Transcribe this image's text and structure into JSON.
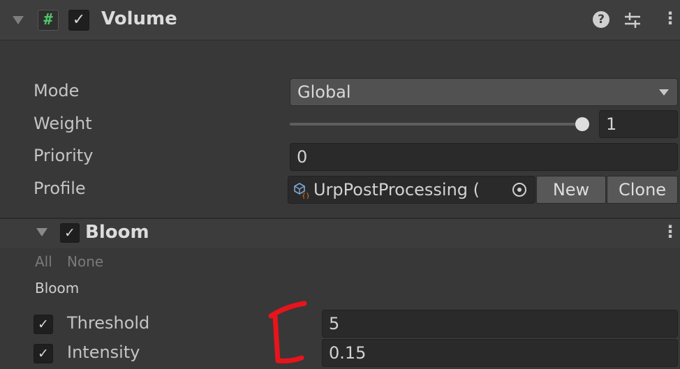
{
  "header": {
    "title": "Volume",
    "script_icon": "hash-icon",
    "enabled": true,
    "help_icon": "help-icon",
    "presets_icon": "presets-sliders-icon",
    "menu_icon": "kebab-menu-icon"
  },
  "fields": {
    "mode": {
      "label": "Mode",
      "value": "Global"
    },
    "weight": {
      "label": "Weight",
      "value": "1",
      "slider_fraction": 1.0
    },
    "priority": {
      "label": "Priority",
      "value": "0"
    },
    "profile": {
      "label": "Profile",
      "value": "UrpPostProcessing (",
      "asset_icon": "scriptable-object-icon",
      "picker_icon": "object-picker-icon",
      "new_label": "New",
      "clone_label": "Clone"
    }
  },
  "bloom": {
    "title": "Bloom",
    "enabled": true,
    "all_label": "All",
    "none_label": "None",
    "group_label": "Bloom",
    "params": [
      {
        "label": "Threshold",
        "value": "5",
        "override": true
      },
      {
        "label": "Intensity",
        "value": "0.15",
        "override": true
      }
    ]
  },
  "colors": {
    "annotation_red": "#e8141c",
    "script_icon_green": "#4fc36a"
  }
}
